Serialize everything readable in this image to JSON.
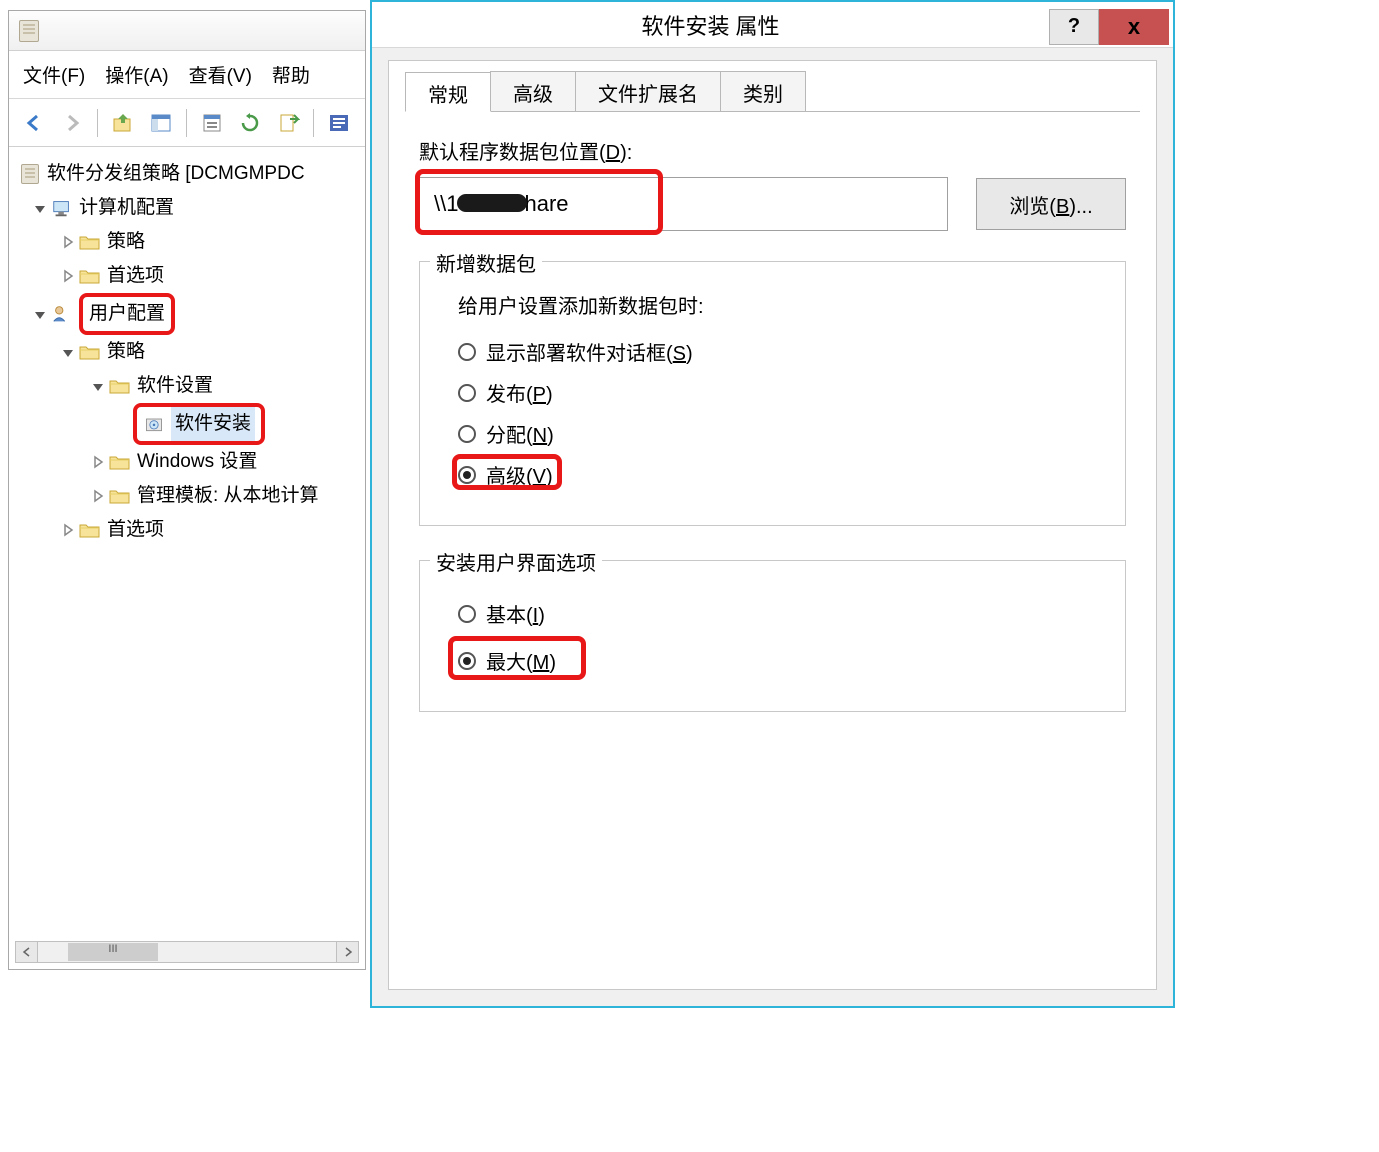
{
  "gpo": {
    "menu": {
      "file": "文件(F)",
      "action": "操作(A)",
      "view": "查看(V)",
      "help": "帮助"
    },
    "tree": {
      "root": "软件分发组策略 [DCMGMPDC",
      "computer_config": "计算机配置",
      "policies": "策略",
      "preferences": "首选项",
      "user_config": "用户配置",
      "software_settings": "软件设置",
      "software_install": "软件安装",
      "windows_settings": "Windows 设置",
      "admin_templates": "管理模板: 从本地计算"
    },
    "scroll_thumb_label": "III"
  },
  "dialog": {
    "title": "软件安装 属性",
    "help": "?",
    "close": "x",
    "tabs": {
      "general": "常规",
      "advanced": "高级",
      "extensions": "文件扩展名",
      "categories": "类别"
    },
    "default_location_label_pre": "默认程序数据包位置(",
    "default_location_key": "D",
    "default_location_label_post": "):",
    "path_prefix": "\\\\1",
    "path_suffix": "\\share",
    "browse_pre": "浏览(",
    "browse_key": "B",
    "browse_post": ")...",
    "new_package_legend": "新增数据包",
    "new_package_desc": "给用户设置添加新数据包时:",
    "radio_deploy_pre": "显示部署软件对话框(",
    "radio_deploy_key": "S",
    "radio_deploy_post": ")",
    "radio_publish_pre": "发布(",
    "radio_publish_key": "P",
    "radio_publish_post": ")",
    "radio_assign_pre": "分配(",
    "radio_assign_key": "N",
    "radio_assign_post": ")",
    "radio_advanced_pre": "高级(",
    "radio_advanced_key": "V",
    "radio_advanced_post": ")",
    "ui_legend": "安装用户界面选项",
    "radio_basic_pre": "基本(",
    "radio_basic_key": "I",
    "radio_basic_post": ")",
    "radio_max_pre": "最大(",
    "radio_max_key": "M",
    "radio_max_post": ")"
  }
}
